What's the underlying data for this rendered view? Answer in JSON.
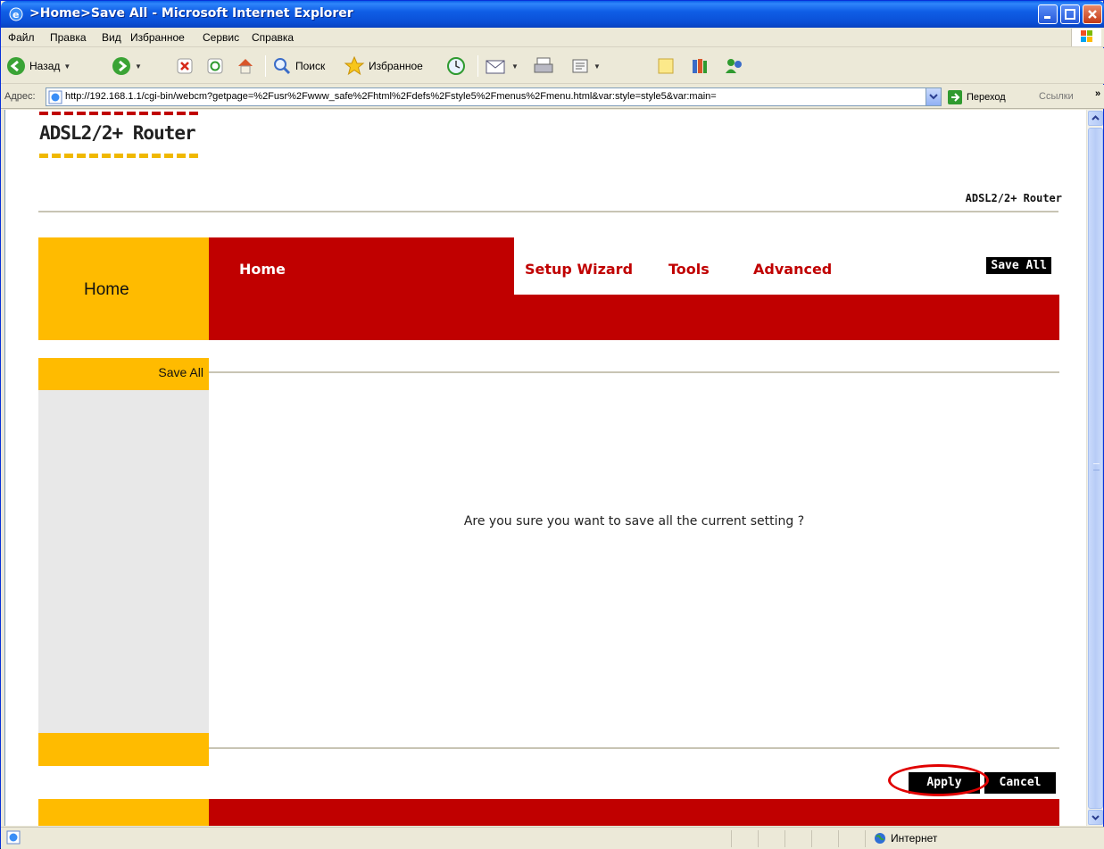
{
  "window": {
    "title": ">Home>Save All - Microsoft Internet Explorer"
  },
  "menu": [
    "Файл",
    "Правка",
    "Вид",
    "Избранное",
    "Сервис",
    "Справка"
  ],
  "toolbar": {
    "back": "Назад",
    "search": "Поиск",
    "favorites": "Избранное"
  },
  "address": {
    "label": "Адрес:",
    "url": "http://192.168.1.1/cgi-bin/webcm?getpage=%2Fusr%2Fwww_safe%2Fhtml%2Fdefs%2Fstyle5%2Fmenus%2Fmenu.html&var:style=style5&var:main=",
    "go": "Переход",
    "links": "Ссылки"
  },
  "router": {
    "logo": "ADSL2/2+ Router",
    "brand_right": "ADSL2/2+ Router",
    "section": "Home",
    "nav": {
      "home": "Home",
      "setup_wizard": "Setup Wizard",
      "tools": "Tools",
      "advanced": "Advanced",
      "save_all": "Save All"
    },
    "sidebar_item": "Save All",
    "question": "Are you sure you want to save all the current setting ?",
    "apply": "Apply",
    "cancel": "Cancel",
    "colors": {
      "yellow": "#ffbb00",
      "red": "#c00000"
    }
  },
  "status": {
    "zone": "Интернет"
  }
}
